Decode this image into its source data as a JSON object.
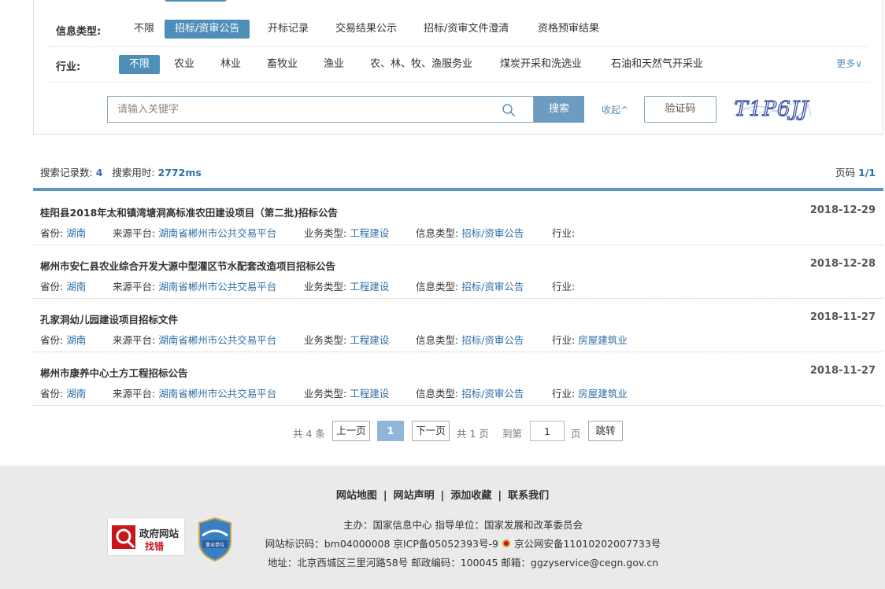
{
  "filters": {
    "info_type": {
      "label": "信息类型:",
      "options": [
        "不限",
        "招标/资审公告",
        "开标记录",
        "交易结果公示",
        "招标/资审文件澄清",
        "资格预审结果"
      ],
      "selected": "招标/资审公告"
    },
    "industry": {
      "label": "行业:",
      "options": [
        "不限",
        "农业",
        "林业",
        "畜牧业",
        "渔业",
        "农、林、牧、渔服务业",
        "煤炭开采和洗选业",
        "石油和天然气开采业"
      ],
      "selected": "不限",
      "more_label": "更多∨"
    },
    "search": {
      "placeholder": "请输入关键字",
      "button_label": "搜索",
      "collapse_label": "收起^",
      "captcha_button_label": "验证码",
      "captcha_text": "T1P6JJ"
    }
  },
  "summary": {
    "count_label": "搜索记录数:",
    "count": "4",
    "time_label": "搜索用时:",
    "time": "2772ms",
    "page_label": "页码",
    "page": "1/1"
  },
  "results": [
    {
      "title": "桂阳县2018年太和镇湾塘洞高标准农田建设项目（第二批)招标公告",
      "date": "2018-12-29",
      "province_label": "省份:",
      "province": "湖南",
      "source_label": "来源平台:",
      "source": "湖南省郴州市公共交易平台",
      "business_label": "业务类型:",
      "business": "工程建设",
      "info_label": "信息类型:",
      "info": "招标/资审公告",
      "industry_label": "行业:",
      "industry": ""
    },
    {
      "title": "郴州市安仁县农业综合开发大源中型灌区节水配套改造项目招标公告",
      "date": "2018-12-28",
      "province_label": "省份:",
      "province": "湖南",
      "source_label": "来源平台:",
      "source": "湖南省郴州市公共交易平台",
      "business_label": "业务类型:",
      "business": "工程建设",
      "info_label": "信息类型:",
      "info": "招标/资审公告",
      "industry_label": "行业:",
      "industry": ""
    },
    {
      "title": "孔家洞幼儿园建设项目招标文件",
      "date": "2018-11-27",
      "province_label": "省份:",
      "province": "湖南",
      "source_label": "来源平台:",
      "source": "湖南省郴州市公共交易平台",
      "business_label": "业务类型:",
      "business": "工程建设",
      "info_label": "信息类型:",
      "info": "招标/资审公告",
      "industry_label": "行业:",
      "industry": "房屋建筑业"
    },
    {
      "title": "郴州市康养中心土方工程招标公告",
      "date": "2018-11-27",
      "province_label": "省份:",
      "province": "湖南",
      "source_label": "来源平台:",
      "source": "湖南省郴州市公共交易平台",
      "business_label": "业务类型:",
      "business": "工程建设",
      "info_label": "信息类型:",
      "info": "招标/资审公告",
      "industry_label": "行业:",
      "industry": "房屋建筑业"
    }
  ],
  "pagination": {
    "total_text": "共 4 条",
    "prev_label": "上一页",
    "current": "1",
    "next_label": "下一页",
    "pages_text": "共 1 页",
    "goto_label": "到第",
    "goto_value": "1",
    "page_unit": "页",
    "jump_label": "跳转"
  },
  "footer": {
    "links": [
      "网站地图",
      "网站声明",
      "添加收藏",
      "联系我们"
    ],
    "host_line": "主办：国家信息中心   指导单位：国家发展和改革委员会",
    "icp_line": "网站标识码：bm04000008  京ICP备05052393号-9",
    "police_line": "京公网安备11010202007733号",
    "address_line": "地址：北京西城区三里河路58号   邮政编码：100045   邮箱：ggzyservice@cegn.gov.cn",
    "gov_badge_title": "政府网站",
    "gov_badge_sub": "找错",
    "unit_badge_label": "事业单位"
  },
  "colors": {
    "accent": "#4e8fb9",
    "link": "#2f6fa6",
    "footer_bg": "#eaeaea"
  }
}
